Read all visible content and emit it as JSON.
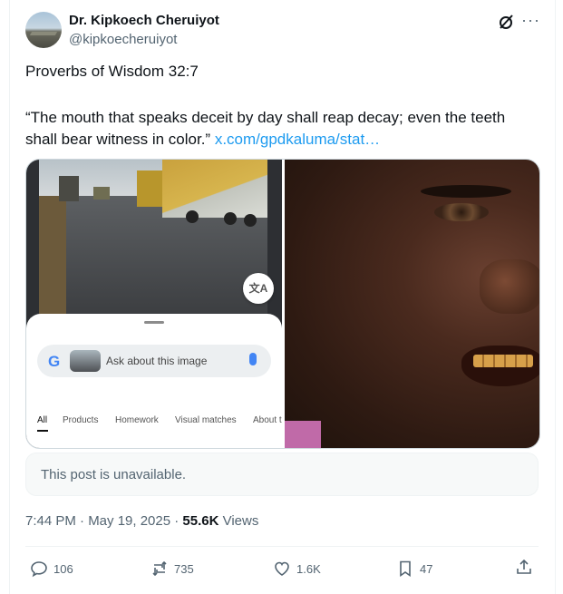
{
  "author": {
    "name": "Dr. Kipkoech Cheruiyot",
    "handle": "@kipkoecheruiyot"
  },
  "post": {
    "line1": "Proverbs of Wisdom 32:7",
    "quote": "“The mouth that speaks deceit by day shall reap decay; even the teeth shall bear witness in color.”",
    "link": "x.com/gpdkaluma/stat…"
  },
  "lens": {
    "search_placeholder": "Ask about this image",
    "translate_glyph": "文A",
    "tabs": [
      "All",
      "Products",
      "Homework",
      "Visual matches",
      "About t"
    ]
  },
  "quoted": {
    "unavailable": "This post is unavailable."
  },
  "meta": {
    "time": "7:44 PM · May 19, 2025 · ",
    "views_count": "55.6K",
    "views_label": " Views"
  },
  "actions": {
    "replies": "106",
    "reposts": "735",
    "likes": "1.6K",
    "bookmarks": "47"
  },
  "colors": {
    "link": "#1d9bf0",
    "secondary_text": "#536471"
  },
  "icons": [
    "grok-icon",
    "more-icon",
    "reply-icon",
    "repost-icon",
    "like-icon",
    "bookmark-icon",
    "share-icon"
  ]
}
